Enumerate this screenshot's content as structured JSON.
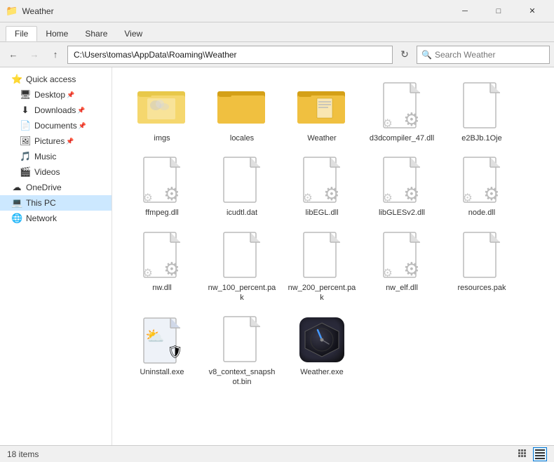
{
  "titleBar": {
    "icon": "📁",
    "title": "Weather",
    "buttons": {
      "minimize": "─",
      "maximize": "□",
      "close": "✕"
    }
  },
  "tabs": [
    "File",
    "Home",
    "Share",
    "View"
  ],
  "activeTab": "File",
  "addressBar": {
    "path": "C:\\Users\\tomas\\AppData\\Roaming\\Weather",
    "searchPlaceholder": "Search Weather",
    "searchLabel": "Search Weather"
  },
  "sidebar": {
    "quickAccess": {
      "label": "Quick access",
      "items": [
        {
          "id": "desktop",
          "label": "Desktop",
          "icon": "🖥",
          "pinned": true
        },
        {
          "id": "downloads",
          "label": "Downloads",
          "icon": "⬇",
          "pinned": true
        },
        {
          "id": "documents",
          "label": "Documents",
          "icon": "📄",
          "pinned": true
        },
        {
          "id": "pictures",
          "label": "Pictures",
          "icon": "🖼",
          "pinned": true
        },
        {
          "id": "music",
          "label": "Music",
          "icon": "🎵",
          "pinned": false
        },
        {
          "id": "videos",
          "label": "Videos",
          "icon": "🎬",
          "pinned": false
        }
      ]
    },
    "oneDrive": {
      "label": "OneDrive",
      "icon": "☁"
    },
    "thisPC": {
      "label": "This PC",
      "icon": "💻",
      "active": true
    },
    "network": {
      "label": "Network",
      "icon": "🌐"
    }
  },
  "files": [
    {
      "id": "imgs",
      "label": "imgs",
      "type": "folder-image"
    },
    {
      "id": "locales",
      "label": "locales",
      "type": "folder-plain"
    },
    {
      "id": "weather-folder",
      "label": "Weather",
      "type": "folder-docs"
    },
    {
      "id": "d3dcompiler",
      "label": "d3dcompiler_47.dll",
      "type": "dll"
    },
    {
      "id": "e2bjb",
      "label": "e2BJb.1Oje",
      "type": "generic"
    },
    {
      "id": "ffmpeg",
      "label": "ffmpeg.dll",
      "type": "dll"
    },
    {
      "id": "icudtl",
      "label": "icudtl.dat",
      "type": "dat"
    },
    {
      "id": "libegl",
      "label": "libEGL.dll",
      "type": "dll"
    },
    {
      "id": "libgles",
      "label": "libGLESv2.dll",
      "type": "dll"
    },
    {
      "id": "node",
      "label": "node.dll",
      "type": "dll"
    },
    {
      "id": "nw",
      "label": "nw.dll",
      "type": "dll"
    },
    {
      "id": "nw100",
      "label": "nw_100_percent.pak",
      "type": "pak"
    },
    {
      "id": "nw200",
      "label": "nw_200_percent.pak",
      "type": "pak"
    },
    {
      "id": "nwelf",
      "label": "nw_elf.dll",
      "type": "dll"
    },
    {
      "id": "resources",
      "label": "resources.pak",
      "type": "pak"
    },
    {
      "id": "uninstall",
      "label": "Uninstall.exe",
      "type": "uninstall-exe"
    },
    {
      "id": "v8snapshot",
      "label": "v8_context_snapshot.bin",
      "type": "bin"
    },
    {
      "id": "weather-exe",
      "label": "Weather.exe",
      "type": "weather-exe"
    }
  ],
  "statusBar": {
    "itemCount": "18 items",
    "viewIcons": [
      "list",
      "detail"
    ]
  }
}
